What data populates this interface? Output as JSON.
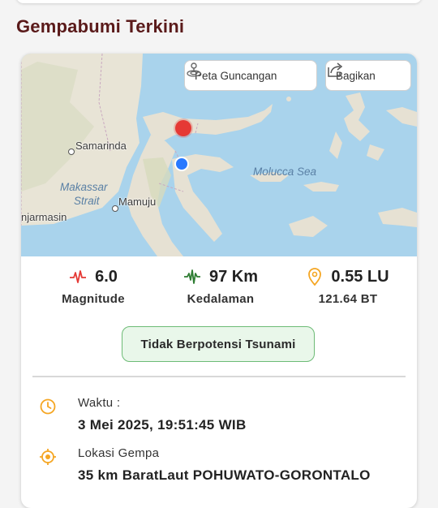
{
  "section": {
    "title": "Gempabumi Terkini"
  },
  "map": {
    "buttons": {
      "shake_map": "Peta Guncangan",
      "share": "Bagikan"
    },
    "labels": {
      "samarinda": "Samarinda",
      "makassar_strait_1": "Makassar",
      "makassar_strait_2": "Strait",
      "mamuju": "Mamuju",
      "banjarmasin": "njarmasin",
      "molucca_sea": "Molucca Sea"
    }
  },
  "stats": {
    "magnitude": {
      "value": "6.0",
      "label": "Magnitude"
    },
    "depth": {
      "value": "97 Km",
      "label": "Kedalaman"
    },
    "coords": {
      "value": "0.55 LU",
      "label": "121.64 BT"
    }
  },
  "tsunami": {
    "status": "Tidak Berpotensi Tsunami"
  },
  "details": {
    "time": {
      "label": "Waktu :",
      "value": "3 Mei 2025, 19:51:45 WIB"
    },
    "location": {
      "label": "Lokasi Gempa",
      "value": "35 km BaratLaut POHUWATO-GORONTALO"
    }
  },
  "colors": {
    "title": "#5a1a1a",
    "quake_marker": "#e53935",
    "user_marker": "#2979ff",
    "tsunami_bg": "#e9f7ea",
    "tsunami_border": "#6dbb76",
    "icon_orange": "#f5a623"
  }
}
